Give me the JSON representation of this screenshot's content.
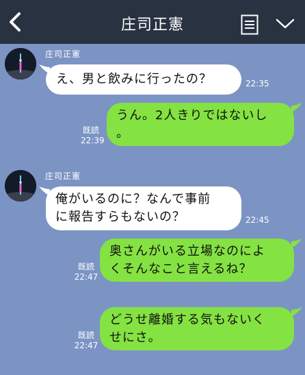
{
  "header": {
    "title": "庄司正憲",
    "back_icon": "chevron-left-icon",
    "menu_icon": "list-icon",
    "expand_icon": "chevron-down-icon"
  },
  "colors": {
    "background": "#7b94c4",
    "header": "#283241",
    "outgoing_bubble": "#84e242",
    "incoming_bubble": "#ffffff"
  },
  "messages": [
    {
      "direction": "in",
      "sender": "庄司正憲",
      "lines": [
        "え、男と飲みに行ったの？"
      ],
      "time": "22:35"
    },
    {
      "direction": "out",
      "lines": [
        "うん。2人きりではないし",
        "。"
      ],
      "read": "既読",
      "time": "22:39"
    },
    {
      "direction": "in",
      "sender": "庄司正憲",
      "lines": [
        "俺がいるのに？なんで事前",
        "に報告すらもないの？"
      ],
      "time": "22:45"
    },
    {
      "direction": "out",
      "lines": [
        "奥さんがいる立場なのによ",
        "くそんなこと言えるね？"
      ],
      "read": "既読",
      "time": "22:47"
    },
    {
      "direction": "out",
      "lines": [
        "どうせ離婚する気もないく",
        "せにさ。"
      ],
      "read": "既読",
      "time": "22:47"
    }
  ]
}
